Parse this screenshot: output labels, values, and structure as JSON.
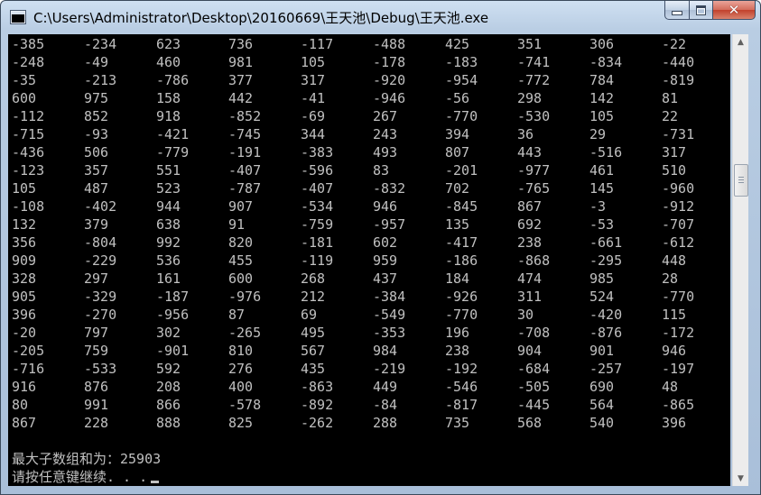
{
  "window": {
    "title": "C:\\Users\\Administrator\\Desktop\\20160669\\王天池\\Debug\\王天池.exe",
    "icon": "console-window-icon"
  },
  "controls": {
    "minimize_icon": "minimize-icon",
    "maximize_icon": "maximize-icon",
    "close_icon": "close-icon",
    "close_color": "#c2412c"
  },
  "console": {
    "background": "#000000",
    "text_color": "#c0c0c0",
    "rows": [
      [
        "-385",
        "-234",
        "623",
        "736",
        "-117",
        "-488",
        "425",
        "351",
        "306",
        "-22"
      ],
      [
        "-248",
        "-49",
        "460",
        "981",
        "105",
        "-178",
        "-183",
        "-741",
        "-834",
        "-440"
      ],
      [
        "-35",
        "-213",
        "-786",
        "377",
        "317",
        "-920",
        "-954",
        "-772",
        "784",
        "-819"
      ],
      [
        "600",
        "975",
        "158",
        "442",
        "-41",
        "-946",
        "-56",
        "298",
        "142",
        "81"
      ],
      [
        "-112",
        "852",
        "918",
        "-852",
        "-69",
        "267",
        "-770",
        "-530",
        "105",
        "22"
      ],
      [
        "-715",
        "-93",
        "-421",
        "-745",
        "344",
        "243",
        "394",
        "36",
        "29",
        "-731"
      ],
      [
        "-436",
        "506",
        "-779",
        "-191",
        "-383",
        "493",
        "807",
        "443",
        "-516",
        "317"
      ],
      [
        "-123",
        "357",
        "551",
        "-407",
        "-596",
        "83",
        "-201",
        "-977",
        "461",
        "510"
      ],
      [
        "105",
        "487",
        "523",
        "-787",
        "-407",
        "-832",
        "702",
        "-765",
        "145",
        "-960"
      ],
      [
        "-108",
        "-402",
        "944",
        "907",
        "-534",
        "946",
        "-845",
        "867",
        "-3",
        "-912"
      ],
      [
        "132",
        "379",
        "638",
        "91",
        "-759",
        "-957",
        "135",
        "692",
        "-53",
        "-707"
      ],
      [
        "356",
        "-804",
        "992",
        "820",
        "-181",
        "602",
        "-417",
        "238",
        "-661",
        "-612"
      ],
      [
        "909",
        "-229",
        "536",
        "455",
        "-119",
        "959",
        "-186",
        "-868",
        "-295",
        "448"
      ],
      [
        "328",
        "297",
        "161",
        "600",
        "268",
        "437",
        "184",
        "474",
        "985",
        "28"
      ],
      [
        "905",
        "-329",
        "-187",
        "-976",
        "212",
        "-384",
        "-926",
        "311",
        "524",
        "-770"
      ],
      [
        "396",
        "-270",
        "-956",
        "87",
        "69",
        "-549",
        "-770",
        "30",
        "-420",
        "115"
      ],
      [
        "-20",
        "797",
        "302",
        "-265",
        "495",
        "-353",
        "196",
        "-708",
        "-876",
        "-172"
      ],
      [
        "-205",
        "759",
        "-901",
        "810",
        "567",
        "984",
        "238",
        "904",
        "901",
        "946"
      ],
      [
        "-716",
        "-533",
        "592",
        "276",
        "435",
        "-219",
        "-192",
        "-684",
        "-257",
        "-197"
      ],
      [
        "916",
        "876",
        "208",
        "400",
        "-863",
        "449",
        "-546",
        "-505",
        "690",
        "48"
      ],
      [
        "80",
        "991",
        "866",
        "-578",
        "-892",
        "-84",
        "-817",
        "-445",
        "564",
        "-865"
      ],
      [
        "867",
        "228",
        "888",
        "825",
        "-262",
        "288",
        "735",
        "568",
        "540",
        "396"
      ]
    ],
    "result_line": "最大子数组和为：25903",
    "prompt_line": "请按任意键继续. . ."
  },
  "scrollbar": {
    "up_icon": "scroll-up-arrow-icon",
    "down_icon": "scroll-down-arrow-icon"
  }
}
